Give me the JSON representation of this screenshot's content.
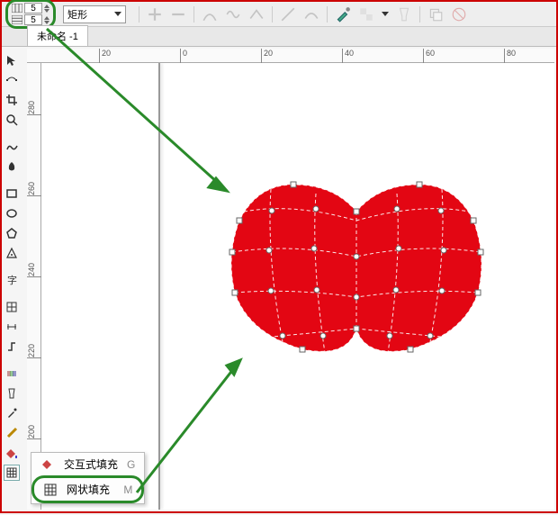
{
  "grid": {
    "cols": "5",
    "rows": "5"
  },
  "shape_dropdown": {
    "label": "矩形"
  },
  "tab": {
    "name": "未命名 -1"
  },
  "ruler_h": [
    {
      "pos": 80,
      "label": "20"
    },
    {
      "pos": 170,
      "label": "0"
    },
    {
      "pos": 260,
      "label": "20"
    },
    {
      "pos": 350,
      "label": "40"
    },
    {
      "pos": 440,
      "label": "60"
    },
    {
      "pos": 530,
      "label": "80"
    }
  ],
  "ruler_v": [
    {
      "pos": 40,
      "label": "280"
    },
    {
      "pos": 130,
      "label": "260"
    },
    {
      "pos": 220,
      "label": "240"
    },
    {
      "pos": 310,
      "label": "220"
    },
    {
      "pos": 400,
      "label": "200"
    }
  ],
  "flyout": {
    "interactive": {
      "label": "交互式填充",
      "key": "G"
    },
    "mesh": {
      "label": "网状填充",
      "key": "M"
    }
  },
  "colors": {
    "shape_fill": "#e30613",
    "annotation": "#2a8a2a"
  }
}
